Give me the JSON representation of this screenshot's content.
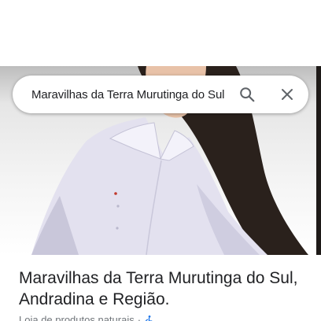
{
  "search": {
    "query": "Maravilhas da Terra Murutinga do Sul"
  },
  "place": {
    "title": "Maravilhas da Terra Murutinga do Sul, Andradina e Região.",
    "category": "Loja de produtos naturais",
    "separator": "·"
  },
  "icons": {
    "search": "search-icon",
    "close": "close-icon",
    "accessibility": "wheelchair-icon"
  },
  "colors": {
    "accessibility_icon": "#1a73e8",
    "icon_gray": "#5f6368",
    "title_text": "#202124",
    "subtitle_text": "#70757a"
  }
}
